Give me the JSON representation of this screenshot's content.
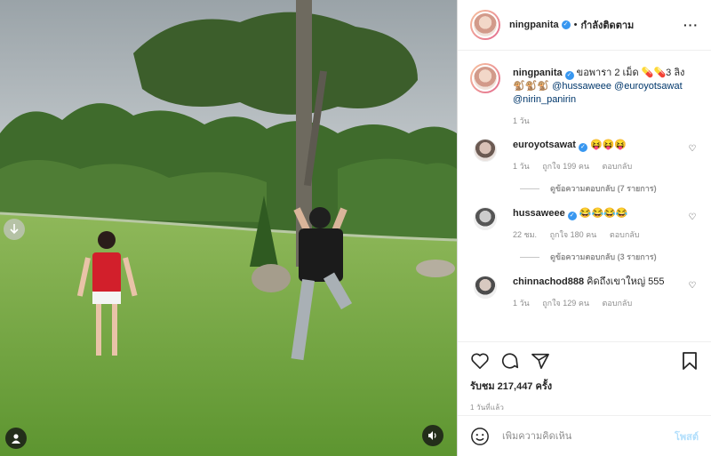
{
  "colors": {
    "link": "#00376b",
    "verified": "#3897f0",
    "post_disabled": "#b2dffc",
    "meta": "#8e8e8e"
  },
  "header": {
    "username": "ningpanita",
    "separator": "•",
    "follow_status": "กำลังติดตาม",
    "more_icon": "more-horizontal-icon"
  },
  "caption": {
    "username": "ningpanita",
    "text": "ขอพารา 2 เม็ด 💊💊3 ลิง",
    "monkeys": "🐒🐒🐒",
    "mention1": "@hussaweee",
    "mention2": "@euroyotsawat",
    "mention3": "@nirin_panirin",
    "time": "1 วัน"
  },
  "comments": [
    {
      "username": "euroyotsawat",
      "text": "😝😝😝",
      "time": "1 วัน",
      "likes": "ถูกใจ 199 คน",
      "reply": "ตอบกลับ",
      "view_replies": "ดูข้อความตอบกลับ (7 รายการ)"
    },
    {
      "username": "hussaweee",
      "text": "😂😂😂😂",
      "time": "22 ชม.",
      "likes": "ถูกใจ 180 คน",
      "reply": "ตอบกลับ",
      "view_replies": "ดูข้อความตอบกลับ (3 รายการ)"
    },
    {
      "username": "chinnachod888",
      "text": "คิดถึงเขาใหญ่ 555",
      "time": "1 วัน",
      "likes": "ถูกใจ 129 คน",
      "reply": "ตอบกลับ"
    }
  ],
  "actions": {
    "icons": [
      "heart-icon",
      "comment-icon",
      "share-icon",
      "bookmark-icon"
    ],
    "views": "รับชม 217,447 ครั้ง",
    "posted_ago": "1 วันที่แล้ว"
  },
  "add_comment": {
    "placeholder": "เพิ่มความคิดเห็น",
    "post_label": "โพสต์"
  },
  "media": {
    "overlay_icons": [
      "arrow-down-icon",
      "user-tag-icon",
      "volume-icon"
    ]
  }
}
